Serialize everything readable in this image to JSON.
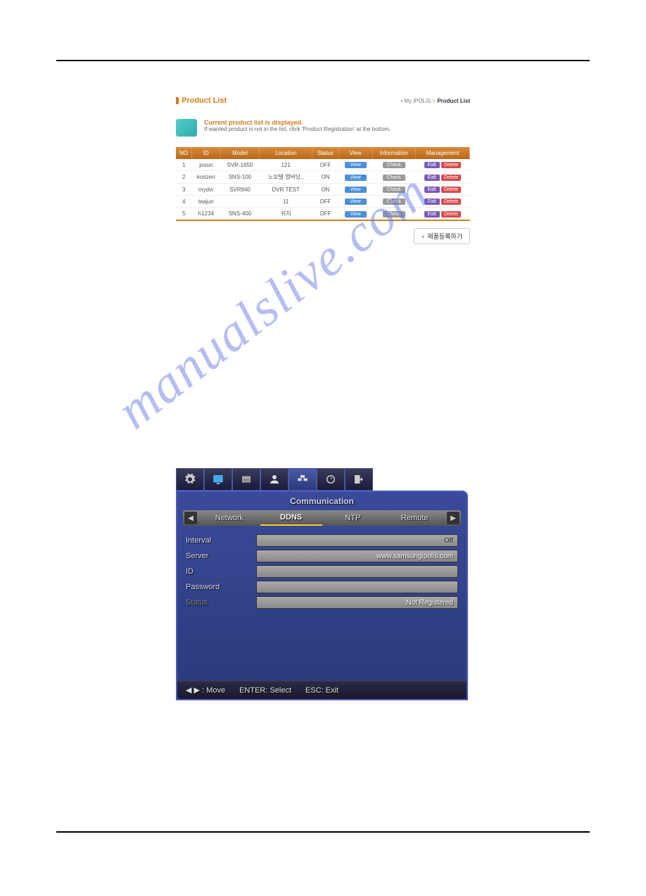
{
  "productList": {
    "title": "Product List",
    "breadcrumb": {
      "parent": "My iPOLiS",
      "current": "Product List"
    },
    "info": {
      "headline": "Current product list is displayed.",
      "sub": "If wanted product is not in the list, click 'Product Registration' at the bottom."
    },
    "columns": [
      "NO",
      "ID",
      "Model",
      "Location",
      "Status",
      "View",
      "Information",
      "Management"
    ],
    "rows": [
      {
        "no": "1",
        "id": "josun",
        "model": "SVR-1650",
        "location": "121",
        "status": "OFF"
      },
      {
        "no": "2",
        "id": "korizen",
        "model": "SNS-100",
        "location": "노보텔 앰버당..",
        "status": "ON"
      },
      {
        "no": "3",
        "id": "mydvr",
        "model": "SVR940",
        "location": "DVR TEST",
        "status": "ON"
      },
      {
        "no": "4",
        "id": "teajun",
        "model": "",
        "location": "11",
        "status": "OFF"
      },
      {
        "no": "5",
        "id": "h1234",
        "model": "SNS-400",
        "location": "위치",
        "status": "OFF"
      }
    ],
    "buttons": {
      "view": "View",
      "check": "Check",
      "edit": "Eidt",
      "delete": "Delete",
      "register": "제품등록하기"
    }
  },
  "watermark": "manualslive.com",
  "dvr": {
    "title": "Communication",
    "subtabs": [
      "Network",
      "DDNS",
      "NTP",
      "Remote"
    ],
    "activeSubtab": 1,
    "fields": {
      "interval": {
        "label": "Interval",
        "value": "Off"
      },
      "server": {
        "label": "Server",
        "value": "www.samsungipolis.com"
      },
      "id": {
        "label": "ID",
        "value": ""
      },
      "password": {
        "label": "Password",
        "value": ""
      },
      "status": {
        "label": "Status",
        "value": "Not Registered"
      }
    },
    "footer": {
      "move": ": Move",
      "select": "ENTER: Select",
      "exit": "ESC: Exit"
    }
  }
}
